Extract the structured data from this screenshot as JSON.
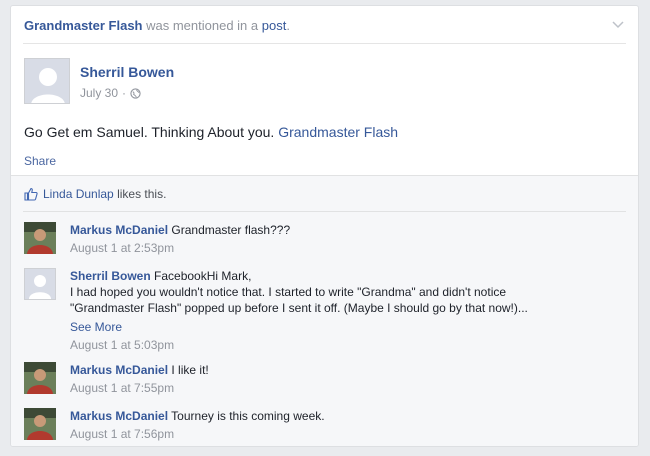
{
  "header": {
    "mention_name": "Grandmaster Flash",
    "mention_middle": " was mentioned in a ",
    "mention_post": "post",
    "mention_end": "."
  },
  "post": {
    "author": "Sherril Bowen",
    "date": "July 30",
    "separator": "·",
    "text_prefix": "Go Get em Samuel. Thinking About you. ",
    "text_link": "Grandmaster Flash",
    "share_label": "Share"
  },
  "likes": {
    "name": "Linda Dunlap",
    "suffix": " likes this."
  },
  "comments": [
    {
      "name": "Markus McDaniel",
      "text": "Grandmaster flash???",
      "time": "August 1 at 2:53pm"
    },
    {
      "name": "Sherril Bowen",
      "text_lines": [
        "FacebookHi Mark,",
        "I had hoped you wouldn't notice that. I started to write \"Grandma\" and didn't notice",
        "\"Grandmaster Flash\" popped up before I sent it off. (Maybe I should go by that now!)..."
      ],
      "see_more": "See More",
      "time": "August 1 at 5:03pm"
    },
    {
      "name": "Markus McDaniel",
      "text": "I like it!",
      "time": "August 1 at 7:55pm"
    },
    {
      "name": "Markus McDaniel",
      "text": "Tourney is this coming week.",
      "time": "August 1 at 7:56pm"
    }
  ],
  "icons": {
    "chevron": "chevron-down-icon",
    "globe": "globe-icon",
    "like": "thumbs-up-icon"
  },
  "colors": {
    "link": "#365899",
    "meta": "#90949c",
    "text": "#1d2129",
    "ufi_bg": "#f6f7f9"
  }
}
